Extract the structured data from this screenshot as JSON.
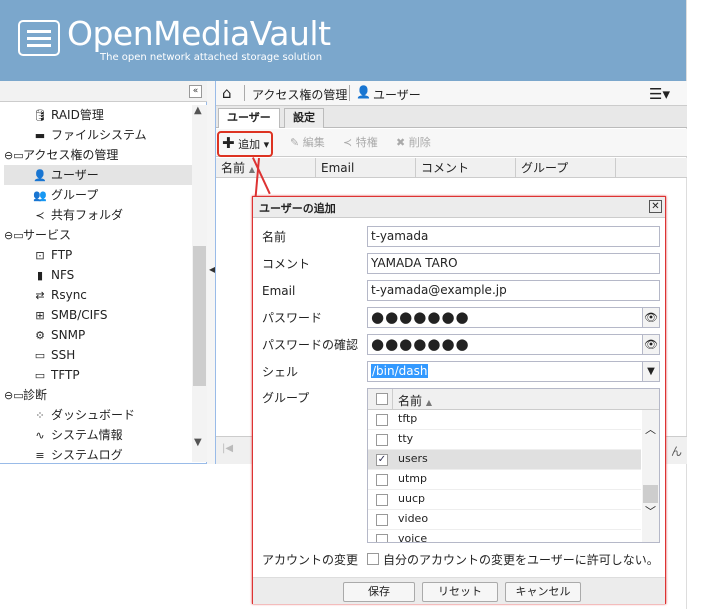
{
  "header": {
    "title": "OpenMediaVault",
    "subtitle": "The open network attached storage solution"
  },
  "tree": {
    "items": [
      {
        "label": "RAID管理",
        "icon": "database-icon"
      },
      {
        "label": "ファイルシステム",
        "icon": "folder-icon"
      },
      {
        "label": "アクセス権の管理",
        "icon": "folder-open-icon"
      },
      {
        "label": "ユーザー",
        "icon": "user-icon"
      },
      {
        "label": "グループ",
        "icon": "group-icon"
      },
      {
        "label": "共有フォルダ",
        "icon": "share-icon"
      },
      {
        "label": "サービス",
        "icon": "folder-open-icon"
      },
      {
        "label": "FTP",
        "icon": "ftp-icon"
      },
      {
        "label": "NFS",
        "icon": "file-icon"
      },
      {
        "label": "Rsync",
        "icon": "rsync-icon"
      },
      {
        "label": "SMB/CIFS",
        "icon": "windows-icon"
      },
      {
        "label": "SNMP",
        "icon": "snmp-icon"
      },
      {
        "label": "SSH",
        "icon": "terminal-icon"
      },
      {
        "label": "TFTP",
        "icon": "monitor-icon"
      },
      {
        "label": "診断",
        "icon": "folder-open-icon"
      },
      {
        "label": "ダッシュボード",
        "icon": "dashboard-icon"
      },
      {
        "label": "システム情報",
        "icon": "chart-icon"
      },
      {
        "label": "システムログ",
        "icon": "log-icon"
      }
    ]
  },
  "breadcrumb": {
    "section": "アクセス権の管理",
    "page": "ユーザー"
  },
  "tabs": [
    "ユーザー",
    "設定"
  ],
  "toolbar": {
    "add": "追加",
    "edit": "編集",
    "privileges": "特権",
    "delete": "削除"
  },
  "grid": {
    "columns": [
      "名前",
      "Email",
      "コメント",
      "グループ"
    ]
  },
  "pager": {
    "right_text": "ん"
  },
  "dialog": {
    "title": "ユーザーの追加",
    "fields": {
      "name": {
        "label": "名前",
        "value": "t-yamada"
      },
      "comment": {
        "label": "コメント",
        "value": "YAMADA TARO"
      },
      "email": {
        "label": "Email",
        "value": "t-yamada@example.jp"
      },
      "password": {
        "label": "パスワード",
        "value": "●●●●●●●"
      },
      "password_confirm": {
        "label": "パスワードの確認",
        "value": "●●●●●●●"
      },
      "shell": {
        "label": "シェル",
        "value": "/bin/dash"
      },
      "groups": {
        "label": "グループ"
      }
    },
    "group_grid": {
      "column": "名前",
      "rows": [
        {
          "name": "tftp",
          "checked": false
        },
        {
          "name": "tty",
          "checked": false
        },
        {
          "name": "users",
          "checked": true
        },
        {
          "name": "utmp",
          "checked": false
        },
        {
          "name": "uucp",
          "checked": false
        },
        {
          "name": "video",
          "checked": false
        },
        {
          "name": "voice",
          "checked": false
        }
      ]
    },
    "account_change": {
      "label": "アカウントの変更",
      "text": "自分のアカウントの変更をユーザーに許可しない。"
    },
    "buttons": {
      "save": "保存",
      "reset": "リセット",
      "cancel": "キャンセル"
    }
  },
  "colors": {
    "header_bg": "#7ba7cc",
    "callout": "#d33333"
  }
}
